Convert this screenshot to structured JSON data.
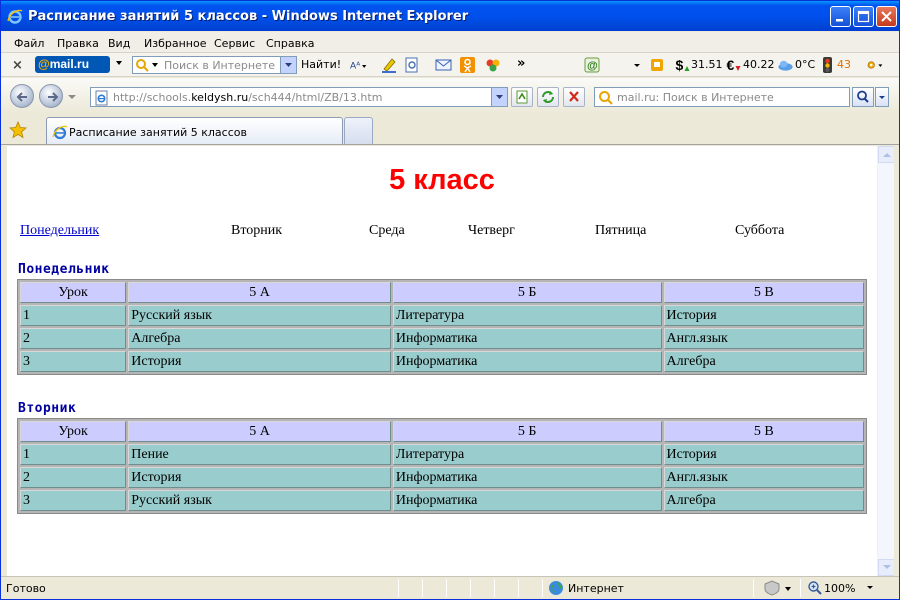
{
  "window": {
    "title": "Расписание занятий 5 классов - Windows Internet Explorer"
  },
  "menu": [
    "Файл",
    "Правка",
    "Вид",
    "Избранное",
    "Сервис",
    "Справка"
  ],
  "mailru_toolbar": {
    "logo": "mail.ru",
    "search_placeholder": "Поиск в Интернете",
    "find_button": "Найти!",
    "more": "»",
    "dollar_rate": "31.51",
    "euro_rate": "40.22",
    "weather": "0°C",
    "traffic": "43"
  },
  "address_bar": {
    "url_prefix": "http://schools.",
    "url_domain": "keldysh.ru",
    "url_path": "/sch444/html/ZB/13.htm",
    "search_placeholder": "mail.ru: Поиск в Интернете"
  },
  "tabs": [
    {
      "label": "Расписание занятий 5 классов",
      "active": true
    }
  ],
  "page": {
    "title": "5 класс",
    "day_nav": [
      {
        "label": "Понедельник",
        "link": true
      },
      {
        "label": "Вторник",
        "link": false
      },
      {
        "label": "Среда",
        "link": false
      },
      {
        "label": "Четверг",
        "link": false
      },
      {
        "label": "Пятница",
        "link": false
      },
      {
        "label": "Суббота",
        "link": false
      }
    ],
    "schedules": [
      {
        "day": "Понедельник",
        "header": [
          "Урок",
          "5 А",
          "5 Б",
          "5 В"
        ],
        "rows": [
          [
            "1",
            "Русский язык",
            "Литература",
            "История"
          ],
          [
            "2",
            "Алгебра",
            "Информатика",
            "Англ.язык"
          ],
          [
            "3",
            "История",
            "Информатика",
            "Алгебра"
          ]
        ]
      },
      {
        "day": "Вторник",
        "header": [
          "Урок",
          "5 А",
          "5 Б",
          "5 В"
        ],
        "rows": [
          [
            "1",
            "Пение",
            "Литература",
            "История"
          ],
          [
            "2",
            "История",
            "Информатика",
            "Англ.язык"
          ],
          [
            "3",
            "Русский язык",
            "Информатика",
            "Алгебра"
          ]
        ]
      }
    ]
  },
  "status_bar": {
    "status": "Готово",
    "zone": "Интернет",
    "zoom": "100%"
  },
  "colors": {
    "title_red": "#ff0000",
    "heading_blue": "#0000a0",
    "header_cell": "#ccccff",
    "row_cell": "#99cccc"
  }
}
